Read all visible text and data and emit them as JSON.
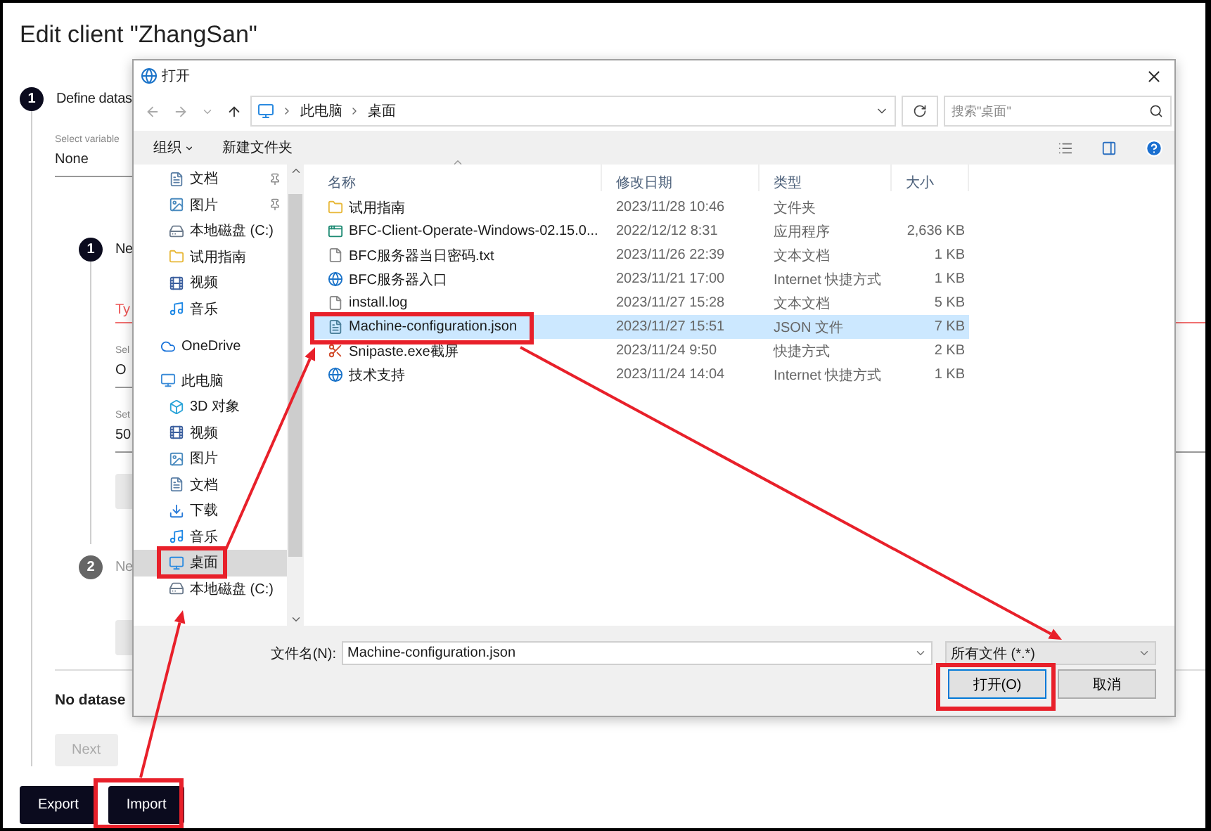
{
  "page": {
    "title": "Edit client \"ZhangSan\"",
    "step": {
      "number": "1",
      "label": "Define datas"
    },
    "variable": {
      "label": "Select variable",
      "value": "None"
    },
    "substeps": [
      {
        "number": "1",
        "label": "Ne",
        "active": true
      },
      {
        "number": "2",
        "label": "Ne",
        "active": false
      }
    ],
    "tab": {
      "label": "Ty",
      "selected": true
    },
    "fields": [
      {
        "label": "Sel",
        "value": "O"
      },
      {
        "label": "Set",
        "value": "50"
      }
    ],
    "empty_text": "No datase",
    "next_button": {
      "label": "Next",
      "disabled": true
    },
    "buttons": [
      "Export",
      "Import"
    ]
  },
  "dialog": {
    "title": "打开",
    "path": [
      "此电脑",
      "桌面"
    ],
    "search_placeholder": "搜索\"桌面\"",
    "toolbar": [
      "组织",
      "新建文件夹"
    ],
    "quick_access": [
      {
        "label": "文档",
        "kind": "doc",
        "pinned": true
      },
      {
        "label": "图片",
        "kind": "picture",
        "pinned": true
      },
      {
        "label": "本地磁盘 (C:)",
        "kind": "drive",
        "pinned": false
      },
      {
        "label": "试用指南",
        "kind": "folder",
        "pinned": false
      },
      {
        "label": "视频",
        "kind": "video",
        "pinned": false
      },
      {
        "label": "音乐",
        "kind": "music",
        "pinned": false
      }
    ],
    "nav_tree": [
      {
        "label": "OneDrive",
        "kind": "cloud",
        "selected": false
      },
      {
        "label": "此电脑",
        "kind": "pc",
        "selected": false,
        "children": [
          {
            "label": "3D 对象",
            "kind": "cube",
            "selected": false
          },
          {
            "label": "视频",
            "kind": "video",
            "selected": false
          },
          {
            "label": "图片",
            "kind": "picture",
            "selected": false
          },
          {
            "label": "文档",
            "kind": "doc",
            "selected": false
          },
          {
            "label": "下载",
            "kind": "download",
            "selected": false
          },
          {
            "label": "音乐",
            "kind": "music",
            "selected": false
          },
          {
            "label": "桌面",
            "kind": "desktop",
            "selected": true
          },
          {
            "label": "本地磁盘 (C:)",
            "kind": "drive",
            "selected": false
          }
        ]
      }
    ],
    "columns": [
      "名称",
      "修改日期",
      "类型",
      "大小"
    ],
    "files": [
      {
        "name": "试用指南",
        "date": "2023/11/28 10:46",
        "type": "文件夹",
        "kind": "folder",
        "selected": false
      },
      {
        "name": "BFC-Client-Operate-Windows-02.15.0...",
        "date": "2022/12/12 8:31",
        "type": "应用程序",
        "size": "2,636 KB",
        "kind": "app",
        "selected": false
      },
      {
        "name": "BFC服务器当日密码.txt",
        "date": "2023/11/26 22:39",
        "type": "文本文档",
        "size": "1 KB",
        "kind": "text",
        "selected": false
      },
      {
        "name": "BFC服务器入口",
        "date": "2023/11/21 17:00",
        "type": "Internet 快捷方式",
        "size": "1 KB",
        "kind": "web",
        "selected": false
      },
      {
        "name": "install.log",
        "date": "2023/11/27 15:28",
        "type": "文本文档",
        "size": "5 KB",
        "kind": "text",
        "selected": false
      },
      {
        "name": "Machine-configuration.json",
        "date": "2023/11/27 15:51",
        "type": "JSON 文件",
        "size": "7 KB",
        "kind": "json",
        "selected": true
      },
      {
        "name": "Snipaste.exe截屏",
        "date": "2023/11/24 9:50",
        "type": "快捷方式",
        "size": "2 KB",
        "kind": "shortcut",
        "selected": false
      },
      {
        "name": "技术支持",
        "date": "2023/11/24 14:04",
        "type": "Internet 快捷方式",
        "size": "1 KB",
        "kind": "web",
        "selected": false
      }
    ],
    "filename_label": "文件名(N):",
    "filename": "Machine-configuration.json",
    "filter": "所有文件 (*.*)",
    "buttons": [
      "打开(O)",
      "取消"
    ]
  }
}
